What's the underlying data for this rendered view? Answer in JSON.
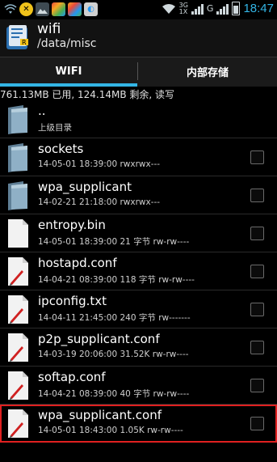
{
  "status_bar": {
    "time": "18:47",
    "network_3g": "3G",
    "network_1x": "1X",
    "network_g": "G",
    "icons": [
      "wifi-signal-icon",
      "mute-icon",
      "gallery-icon",
      "app-icon",
      "app-icon",
      "app-icon",
      "wifi-icon",
      "signal-icon",
      "battery-icon"
    ]
  },
  "header": {
    "title": "wifi",
    "path": "/data/misc"
  },
  "tabs": [
    {
      "label": "WIFI",
      "active": true
    },
    {
      "label": "内部存储",
      "active": false
    }
  ],
  "storage_info": "761.13MB 已用, 124.14MB 剩余, 读写",
  "files": [
    {
      "name": "..",
      "meta": "上级目录",
      "type": "folder",
      "checkbox": false
    },
    {
      "name": "sockets",
      "meta": "14-05-01 18:39:00   rwxrwx---",
      "type": "folder",
      "checkbox": true
    },
    {
      "name": "wpa_supplicant",
      "meta": "14-02-21 21:18:00   rwxrwx---",
      "type": "folder",
      "checkbox": true
    },
    {
      "name": "entropy.bin",
      "meta": "14-05-01 18:39:00  21 字节  rw-rw----",
      "type": "file",
      "checkbox": true
    },
    {
      "name": "hostapd.conf",
      "meta": "14-04-21 08:39:00  118 字节  rw-rw----",
      "type": "text",
      "checkbox": true
    },
    {
      "name": "ipconfig.txt",
      "meta": "14-04-11 21:45:00  240 字节  rw-------",
      "type": "text",
      "checkbox": true
    },
    {
      "name": "p2p_supplicant.conf",
      "meta": "14-03-19 20:06:00  31.52K  rw-rw----",
      "type": "text",
      "checkbox": true
    },
    {
      "name": "softap.conf",
      "meta": "14-04-21 08:39:00  40 字节  rw-rw----",
      "type": "text",
      "checkbox": true
    },
    {
      "name": "wpa_supplicant.conf",
      "meta": "14-05-01 18:43:00  1.05K  rw-rw----",
      "type": "text",
      "checkbox": true,
      "highlighted": true
    }
  ],
  "colors": {
    "accent": "#33b5e5",
    "highlight": "#e02020",
    "folder": "#6f8fa6"
  }
}
